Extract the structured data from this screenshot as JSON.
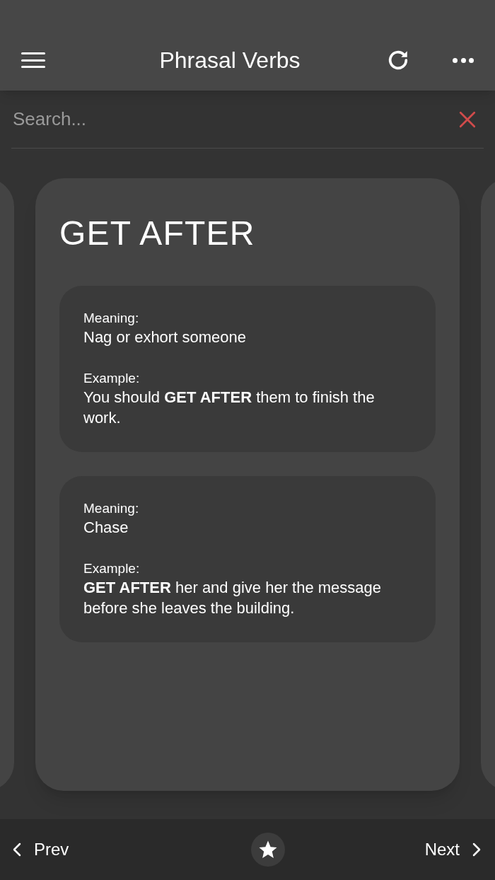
{
  "header": {
    "title": "Phrasal Verbs"
  },
  "search": {
    "placeholder": "Search..."
  },
  "card": {
    "word": "GET AFTER",
    "entries": [
      {
        "meaning_label": "Meaning:",
        "meaning": "Nag or exhort someone",
        "example_label": "Example:",
        "example": "You should **GET AFTER** them to finish the work."
      },
      {
        "meaning_label": "Meaning:",
        "meaning": "Chase",
        "example_label": "Example:",
        "example": "**GET AFTER** her and give her the message before she leaves the building."
      }
    ]
  },
  "nav": {
    "prev": "Prev",
    "next": "Next"
  }
}
